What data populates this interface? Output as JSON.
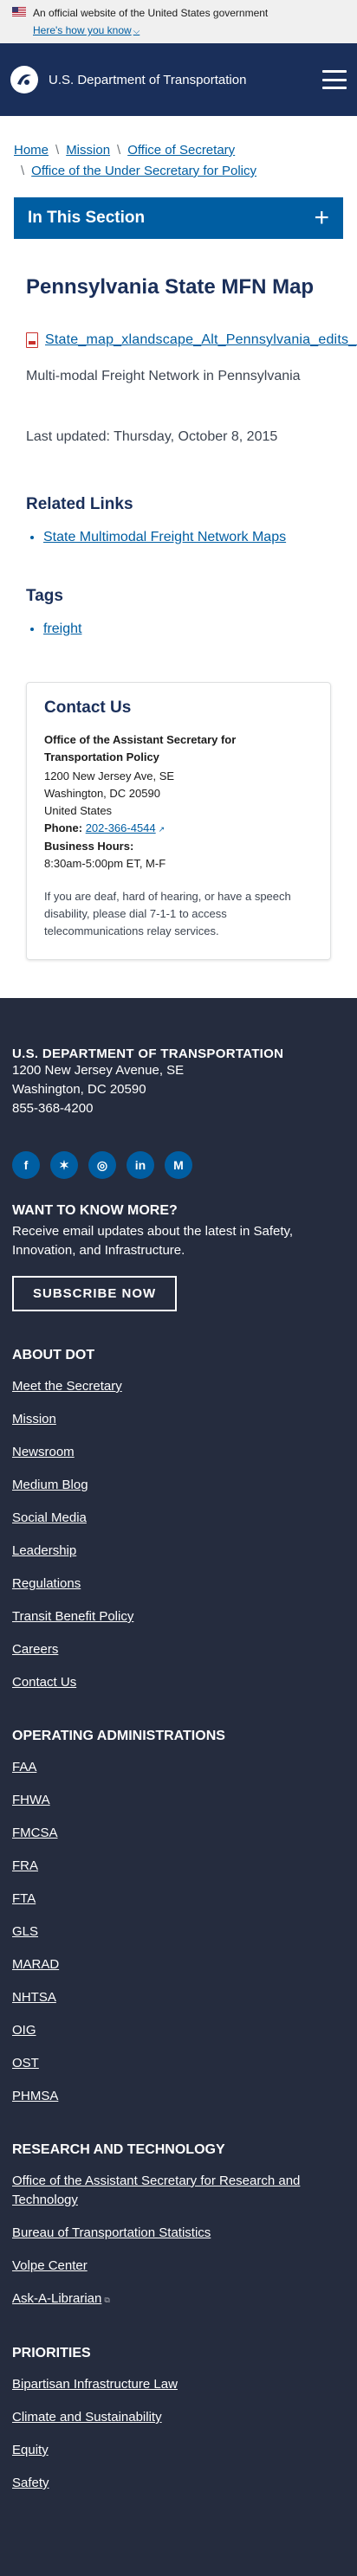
{
  "gov_banner": {
    "text": "An official website of the United States government",
    "link": "Here's how you know"
  },
  "header": {
    "title": "U.S. Department of Transportation"
  },
  "breadcrumb": {
    "items": [
      "Home",
      "Mission",
      "Office of Secretary",
      "Office of the Under Secretary for Policy"
    ]
  },
  "in_section": {
    "label": "In This Section"
  },
  "page": {
    "title": "Pennsylvania State MFN Map",
    "file_link": "State_map_xlandscape_Alt_Pennsylvania_edits_alt",
    "file_desc": "Multi-modal Freight Network in Pennsylvania",
    "last_updated": "Last updated: Thursday, October 8, 2015"
  },
  "related": {
    "heading": "Related Links",
    "links": [
      "State Multimodal Freight Network Maps"
    ]
  },
  "tags": {
    "heading": "Tags",
    "items": [
      "freight"
    ]
  },
  "contact": {
    "heading": "Contact Us",
    "org": "Office of the Assistant Secretary for Transportation Policy",
    "address1": "1200 New Jersey Ave, SE",
    "address2": "Washington, DC 20590",
    "country": "United States",
    "phone_label": "Phone:",
    "phone": "202-366-4544",
    "hours_label": "Business Hours:",
    "hours": "8:30am-5:00pm ET, M-F",
    "note": "If you are deaf, hard of hearing, or have a speech disability, please dial 7-1-1 to access telecommunications relay services."
  },
  "footer": {
    "org": "U.S. DEPARTMENT OF TRANSPORTATION",
    "address1": "1200 New Jersey Avenue, SE",
    "address2": "Washington, DC 20590",
    "phone": "855-368-4200",
    "socials": [
      {
        "icon": "facebook-icon",
        "glyph": "f"
      },
      {
        "icon": "twitter-icon",
        "glyph": "✶"
      },
      {
        "icon": "instagram-icon",
        "glyph": "◎"
      },
      {
        "icon": "linkedin-icon",
        "glyph": "in"
      },
      {
        "icon": "medium-icon",
        "glyph": "M"
      }
    ],
    "want_heading": "WANT TO KNOW MORE?",
    "want_desc": "Receive email updates about the latest in Safety, Innovation, and Infrastructure.",
    "subscribe": "SUBSCRIBE NOW",
    "about": {
      "heading": "ABOUT DOT",
      "links": [
        "Meet the Secretary",
        "Mission",
        "Newsroom",
        "Medium Blog",
        "Social Media",
        "Leadership",
        "Regulations",
        "Transit Benefit Policy",
        "Careers",
        "Contact Us"
      ]
    },
    "operating": {
      "heading": "OPERATING ADMINISTRATIONS",
      "links": [
        "FAA",
        "FHWA",
        "FMCSA",
        "FRA",
        "FTA",
        "GLS",
        "MARAD",
        "NHTSA",
        "OIG",
        "OST",
        "PHMSA"
      ]
    },
    "research": {
      "heading": "RESEARCH AND TECHNOLOGY",
      "links": [
        "Office of the Assistant Secretary for Research and Technology",
        "Bureau of Transportation Statistics",
        "Volpe Center",
        "Ask-A-Librarian"
      ]
    },
    "priorities": {
      "heading": "PRIORITIES",
      "links": [
        "Bipartisan Infrastructure Law",
        "Climate and Sustainability",
        "Equity",
        "Safety"
      ]
    }
  },
  "colors": {
    "header_bg": "#1a2f5a",
    "accent": "#005ea2",
    "footer_bg": "#252c3e"
  }
}
